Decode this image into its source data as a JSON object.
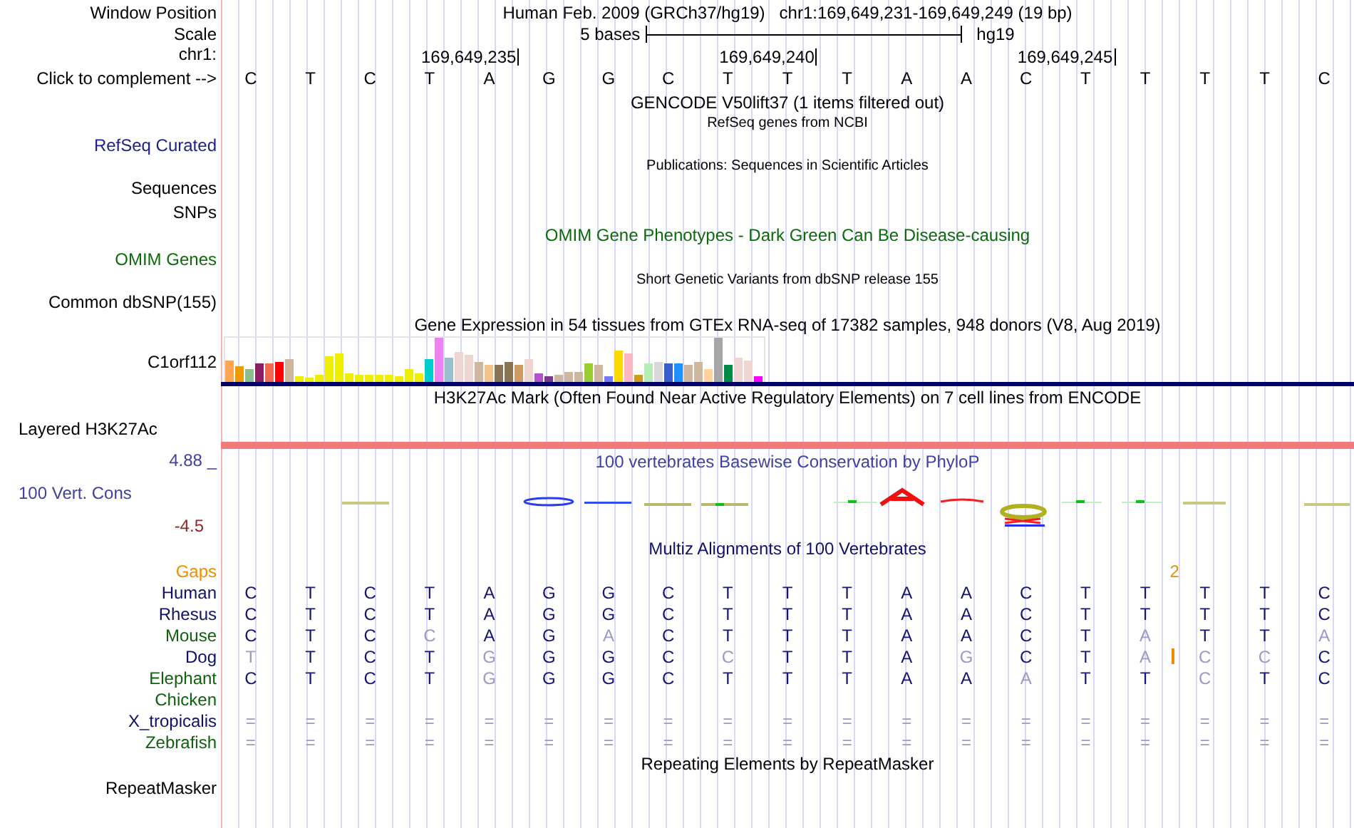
{
  "header": {
    "window_label": "Window Position",
    "assembly_title": "Human Feb. 2009 (GRCh37/hg19)",
    "position": "chr1:169,649,231-169,649,249 (19 bp)",
    "scale_label": "Scale",
    "scale_text": "5 bases",
    "scale_assembly": "hg19",
    "chrom_label": "chr1:",
    "ticks": [
      "169,649,235",
      "169,649,240",
      "169,649,245"
    ],
    "complement_label": "Click to complement -->",
    "bases": [
      "C",
      "T",
      "C",
      "T",
      "A",
      "G",
      "G",
      "C",
      "T",
      "T",
      "T",
      "A",
      "A",
      "C",
      "T",
      "T",
      "T",
      "T",
      "C"
    ]
  },
  "tracks": [
    {
      "kind": "title",
      "text": "GENCODE V50lift37 (1 items filtered out)",
      "color": "#000000"
    },
    {
      "kind": "subtitle",
      "text": "RefSeq genes from NCBI",
      "color": "#000000"
    },
    {
      "kind": "label",
      "text": "RefSeq Curated",
      "color": "#20208c"
    },
    {
      "kind": "subtitle",
      "text": "Publications: Sequences in Scientific Articles",
      "color": "#000000"
    },
    {
      "kind": "label",
      "text": "Sequences",
      "color": "#000000"
    },
    {
      "kind": "label",
      "text": "SNPs",
      "color": "#000000"
    },
    {
      "kind": "title",
      "text": "OMIM Gene Phenotypes - Dark Green Can Be Disease-causing",
      "color": "#0b6b0b"
    },
    {
      "kind": "label",
      "text": "OMIM Genes",
      "color": "#0b6b0b"
    },
    {
      "kind": "subtitle",
      "text": "Short Genetic Variants from dbSNP release 155",
      "color": "#000000"
    },
    {
      "kind": "label",
      "text": "Common dbSNP(155)",
      "color": "#000000"
    },
    {
      "kind": "title",
      "text": "Gene Expression in 54 tissues from GTEx RNA-seq of 17382 samples, 948 donors (V8, Aug 2019)",
      "color": "#000000"
    },
    {
      "kind": "expression",
      "text": "C1orf112",
      "color": "#000000"
    },
    {
      "kind": "title",
      "text": "H3K27Ac Mark (Often Found Near Active Regulatory Elements) on 7 cell lines from ENCODE",
      "color": "#000000"
    },
    {
      "kind": "band",
      "text": "Layered H3K27Ac",
      "color": "#000000"
    },
    {
      "kind": "conservation",
      "text": "100 Vert. Cons",
      "color": "#4040a0",
      "title": "100 vertebrates Basewise Conservation by PhyloP",
      "max": "4.88 _",
      "min": {
        "text": "-4.5",
        "color": "#8c2a2a"
      }
    },
    {
      "kind": "title",
      "text": "Multiz Alignments of 100 Vertebrates",
      "color": "#101068"
    },
    {
      "kind": "gaps",
      "text": "Gaps",
      "color": "#f08c00",
      "marker": "2"
    },
    {
      "kind": "species",
      "text": "Human",
      "color": "#101068",
      "bases": [
        {
          "b": "C",
          "match": true
        },
        {
          "b": "T",
          "match": true
        },
        {
          "b": "C",
          "match": true
        },
        {
          "b": "T",
          "match": true
        },
        {
          "b": "A",
          "match": true
        },
        {
          "b": "G",
          "match": true
        },
        {
          "b": "G",
          "match": true
        },
        {
          "b": "C",
          "match": true
        },
        {
          "b": "T",
          "match": true
        },
        {
          "b": "T",
          "match": true
        },
        {
          "b": "T",
          "match": true
        },
        {
          "b": "A",
          "match": true
        },
        {
          "b": "A",
          "match": true
        },
        {
          "b": "C",
          "match": true
        },
        {
          "b": "T",
          "match": true
        },
        {
          "b": "T",
          "match": true
        },
        {
          "b": "T",
          "match": true
        },
        {
          "b": "T",
          "match": true
        },
        {
          "b": "C",
          "match": true
        }
      ]
    },
    {
      "kind": "species",
      "text": "Rhesus",
      "color": "#101068",
      "bases": [
        {
          "b": "C",
          "match": true
        },
        {
          "b": "T",
          "match": true
        },
        {
          "b": "C",
          "match": true
        },
        {
          "b": "T",
          "match": true
        },
        {
          "b": "A",
          "match": true
        },
        {
          "b": "G",
          "match": true
        },
        {
          "b": "G",
          "match": true
        },
        {
          "b": "C",
          "match": true
        },
        {
          "b": "T",
          "match": true
        },
        {
          "b": "T",
          "match": true
        },
        {
          "b": "T",
          "match": true
        },
        {
          "b": "A",
          "match": true
        },
        {
          "b": "A",
          "match": true
        },
        {
          "b": "C",
          "match": true
        },
        {
          "b": "T",
          "match": true
        },
        {
          "b": "T",
          "match": true
        },
        {
          "b": "T",
          "match": true
        },
        {
          "b": "T",
          "match": true
        },
        {
          "b": "C",
          "match": true
        }
      ]
    },
    {
      "kind": "species",
      "text": "Mouse",
      "color": "#106010",
      "bases": [
        {
          "b": "C",
          "match": true
        },
        {
          "b": "T",
          "match": true
        },
        {
          "b": "C",
          "match": true
        },
        {
          "b": "C",
          "match": false
        },
        {
          "b": "A",
          "match": true
        },
        {
          "b": "G",
          "match": true
        },
        {
          "b": "A",
          "match": false
        },
        {
          "b": "C",
          "match": true
        },
        {
          "b": "T",
          "match": true
        },
        {
          "b": "T",
          "match": true
        },
        {
          "b": "T",
          "match": true
        },
        {
          "b": "A",
          "match": true
        },
        {
          "b": "A",
          "match": true
        },
        {
          "b": "C",
          "match": true
        },
        {
          "b": "T",
          "match": true
        },
        {
          "b": "A",
          "match": false
        },
        {
          "b": "T",
          "match": true
        },
        {
          "b": "T",
          "match": true
        },
        {
          "b": "A",
          "match": false
        }
      ]
    },
    {
      "kind": "species",
      "text": "Dog",
      "color": "#101068",
      "bases": [
        {
          "b": "T",
          "match": false
        },
        {
          "b": "T",
          "match": true
        },
        {
          "b": "C",
          "match": true
        },
        {
          "b": "T",
          "match": true
        },
        {
          "b": "G",
          "match": false
        },
        {
          "b": "G",
          "match": true
        },
        {
          "b": "G",
          "match": true
        },
        {
          "b": "C",
          "match": true
        },
        {
          "b": "C",
          "match": false
        },
        {
          "b": "T",
          "match": true
        },
        {
          "b": "T",
          "match": true
        },
        {
          "b": "A",
          "match": true
        },
        {
          "b": "G",
          "match": false
        },
        {
          "b": "C",
          "match": true
        },
        {
          "b": "T",
          "match": true
        },
        {
          "b": "A",
          "match": false,
          "insert": true
        },
        {
          "b": "C",
          "match": false
        },
        {
          "b": "C",
          "match": false
        },
        {
          "b": "C",
          "match": true
        }
      ]
    },
    {
      "kind": "species",
      "text": "Elephant",
      "color": "#106010",
      "bases": [
        {
          "b": "C",
          "match": true
        },
        {
          "b": "T",
          "match": true
        },
        {
          "b": "C",
          "match": true
        },
        {
          "b": "T",
          "match": true
        },
        {
          "b": "G",
          "match": false
        },
        {
          "b": "G",
          "match": true
        },
        {
          "b": "G",
          "match": true
        },
        {
          "b": "C",
          "match": true
        },
        {
          "b": "T",
          "match": true
        },
        {
          "b": "T",
          "match": true
        },
        {
          "b": "T",
          "match": true
        },
        {
          "b": "A",
          "match": true
        },
        {
          "b": "A",
          "match": true
        },
        {
          "b": "A",
          "match": false
        },
        {
          "b": "T",
          "match": true
        },
        {
          "b": "T",
          "match": true
        },
        {
          "b": "C",
          "match": false
        },
        {
          "b": "T",
          "match": true
        },
        {
          "b": "C",
          "match": true
        }
      ]
    },
    {
      "kind": "species",
      "text": "Chicken",
      "color": "#106010"
    },
    {
      "kind": "species",
      "text": "X_tropicalis",
      "color": "#101068",
      "bases": [
        {
          "b": "=",
          "match": false
        },
        {
          "b": "=",
          "match": false
        },
        {
          "b": "=",
          "match": false
        },
        {
          "b": "=",
          "match": false
        },
        {
          "b": "=",
          "match": false
        },
        {
          "b": "=",
          "match": false
        },
        {
          "b": "=",
          "match": false
        },
        {
          "b": "=",
          "match": false
        },
        {
          "b": "=",
          "match": false
        },
        {
          "b": "=",
          "match": false
        },
        {
          "b": "=",
          "match": false
        },
        {
          "b": "=",
          "match": false
        },
        {
          "b": "=",
          "match": false
        },
        {
          "b": "=",
          "match": false
        },
        {
          "b": "=",
          "match": false
        },
        {
          "b": "=",
          "match": false
        },
        {
          "b": "=",
          "match": false
        },
        {
          "b": "=",
          "match": false
        },
        {
          "b": "=",
          "match": false
        }
      ]
    },
    {
      "kind": "species",
      "text": "Zebrafish",
      "color": "#106010",
      "bases": [
        {
          "b": "=",
          "match": false
        },
        {
          "b": "=",
          "match": false
        },
        {
          "b": "=",
          "match": false
        },
        {
          "b": "=",
          "match": false
        },
        {
          "b": "=",
          "match": false
        },
        {
          "b": "=",
          "match": false
        },
        {
          "b": "=",
          "match": false
        },
        {
          "b": "=",
          "match": false
        },
        {
          "b": "=",
          "match": false
        },
        {
          "b": "=",
          "match": false
        },
        {
          "b": "=",
          "match": false
        },
        {
          "b": "=",
          "match": false
        },
        {
          "b": "=",
          "match": false
        },
        {
          "b": "=",
          "match": false
        },
        {
          "b": "=",
          "match": false
        },
        {
          "b": "=",
          "match": false
        },
        {
          "b": "=",
          "match": false
        },
        {
          "b": "=",
          "match": false
        },
        {
          "b": "=",
          "match": false
        }
      ]
    },
    {
      "kind": "title",
      "text": "Repeating Elements by RepeatMasker",
      "color": "#000000"
    },
    {
      "kind": "label",
      "text": "RepeatMasker",
      "color": "#000000"
    }
  ]
}
